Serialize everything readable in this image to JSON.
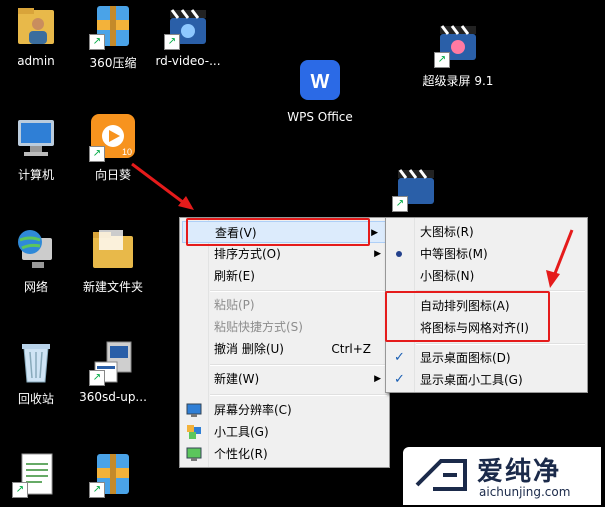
{
  "desktop": {
    "icons": [
      {
        "label": "admin"
      },
      {
        "label": "360压缩"
      },
      {
        "label": "rd-video-..."
      },
      {
        "label": "WPS Office"
      },
      {
        "label": "超级录屏 9.1"
      },
      {
        "label": "计算机"
      },
      {
        "label": "向日葵"
      },
      {
        "label": "网络"
      },
      {
        "label": "新建文件夹"
      },
      {
        "label": "回收站"
      },
      {
        "label": "360sd-up..."
      }
    ],
    "app_tiles": {
      "wps_letter": "W",
      "sunflower_badge": "10"
    }
  },
  "context_menu": {
    "items": [
      {
        "label": "查看(V)"
      },
      {
        "label": "排序方式(O)"
      },
      {
        "label": "刷新(E)"
      },
      {
        "label": "粘贴(P)"
      },
      {
        "label": "粘贴快捷方式(S)"
      },
      {
        "label": "撤消 删除(U)",
        "shortcut": "Ctrl+Z"
      },
      {
        "label": "新建(W)"
      },
      {
        "label": "屏幕分辨率(C)"
      },
      {
        "label": "小工具(G)"
      },
      {
        "label": "个性化(R)"
      }
    ]
  },
  "view_submenu": {
    "items": [
      {
        "label": "大图标(R)"
      },
      {
        "label": "中等图标(M)"
      },
      {
        "label": "小图标(N)"
      },
      {
        "label": "自动排列图标(A)"
      },
      {
        "label": "将图标与网格对齐(I)"
      },
      {
        "label": "显示桌面图标(D)"
      },
      {
        "label": "显示桌面小工具(G)"
      }
    ],
    "check_glyph": "✓"
  },
  "watermark": {
    "brand": "爱纯净",
    "url": "aichunjing.com"
  },
  "colors": {
    "highlight": "#e51b1b",
    "wps": "#2b6ae6",
    "sunflower": "#f7931e"
  }
}
